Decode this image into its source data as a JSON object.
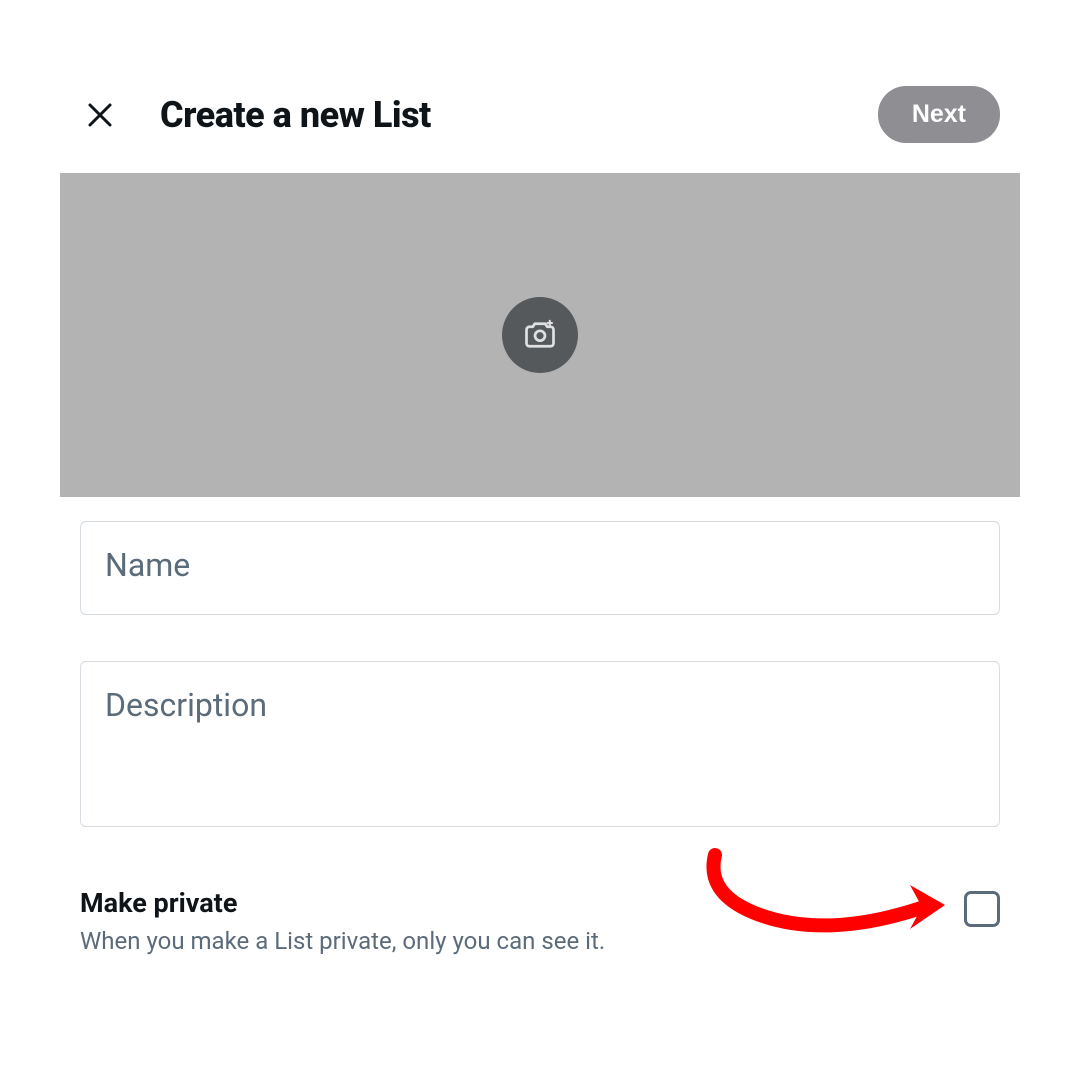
{
  "header": {
    "title": "Create a new List",
    "next_label": "Next"
  },
  "banner": {
    "icon_name": "camera-icon"
  },
  "form": {
    "name_placeholder": "Name",
    "description_placeholder": "Description"
  },
  "private": {
    "title": "Make private",
    "description": "When you make a List private, only you can see it."
  },
  "colors": {
    "banner_bg": "#b3b3b3",
    "next_btn": "#8e8e93",
    "text_muted": "#5b6b7a",
    "annotation": "#ff0000"
  }
}
